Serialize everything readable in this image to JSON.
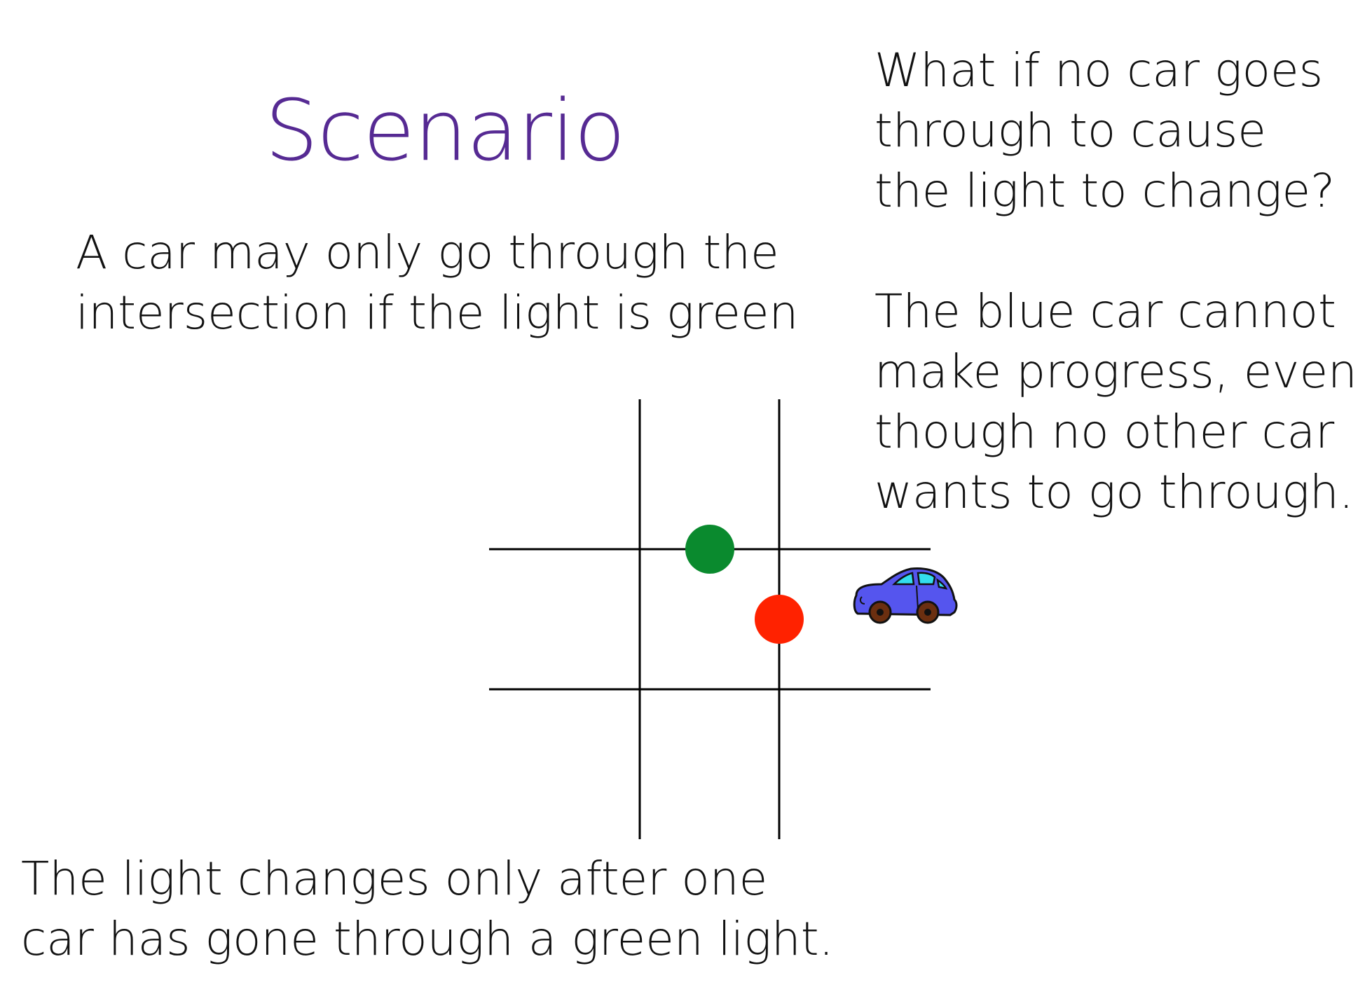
{
  "slide": {
    "title": "Scenario",
    "title_color": "#562a93",
    "rule_lines": [
      "A car may only go through the",
      "intersection if the light is green"
    ],
    "light_change_lines": [
      "The light changes only after one",
      "car has gone through a green light."
    ],
    "question_lines": [
      "What if no car goes",
      "through to cause",
      "the light to change?"
    ],
    "answer_lines": [
      "The blue car cannot",
      "make progress, even",
      "though no other car",
      "wants to go through."
    ]
  },
  "diagram": {
    "green_light_color": "#0a8a2e",
    "red_light_color": "#ff2200",
    "car_body_color": "#5555ee",
    "car_window_color": "#33ddee",
    "car_wheel_color": "#6b2f10",
    "car_icon": "blue-car-icon"
  }
}
